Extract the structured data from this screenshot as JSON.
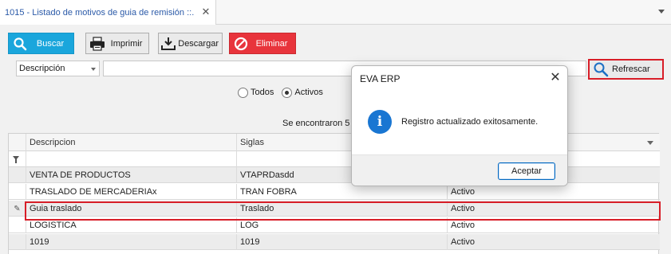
{
  "tab": {
    "title": "1015 - Listado de motivos de guia de remisión ::."
  },
  "toolbar": {
    "buscar": "Buscar",
    "imprimir": "Imprimir",
    "descargar": "Descargar",
    "eliminar": "Eliminar"
  },
  "search": {
    "field": "Descripción",
    "value": "",
    "refresh": "Refrescar"
  },
  "filter": {
    "options": [
      "Todos",
      "Activos"
    ],
    "selected": "Activos"
  },
  "result_text": "Se encontraron 5 r",
  "grid": {
    "columns": [
      "Descripcion",
      "Siglas",
      ""
    ],
    "rows": [
      {
        "descripcion": "VENTA DE PRODUCTOS",
        "siglas": "VTAPRDasdd",
        "estado": ""
      },
      {
        "descripcion": "TRASLADO DE MERCADERIAx",
        "siglas": "TRAN FOBRA",
        "estado": "Activo"
      },
      {
        "descripcion": "Guia traslado",
        "siglas": "Traslado",
        "estado": "Activo"
      },
      {
        "descripcion": "LOGISTICA",
        "siglas": "LOG",
        "estado": "Activo"
      },
      {
        "descripcion": "1019",
        "siglas": "1019",
        "estado": "Activo"
      }
    ]
  },
  "dialog": {
    "title": "EVA ERP",
    "message": "Registro actualizado exitosamente.",
    "ok": "Aceptar"
  },
  "colors": {
    "buscar": "#1aa6dc",
    "eliminar": "#e8343c",
    "highlight": "#d81e28",
    "tab_title": "#2b5aa8",
    "info": "#1976d2"
  }
}
